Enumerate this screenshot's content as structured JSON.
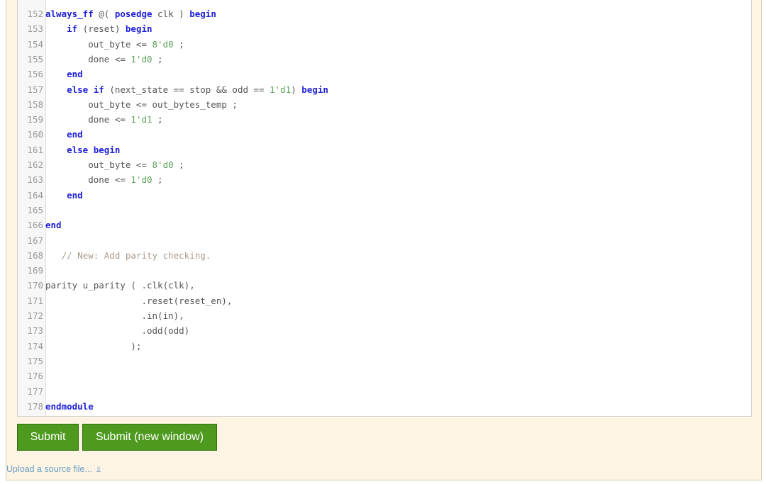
{
  "editor": {
    "lines": [
      {
        "n": "152",
        "segs": [
          {
            "t": "always_ff",
            "c": "kw"
          },
          {
            "t": " @( ",
            "c": "pl"
          },
          {
            "t": "posedge",
            "c": "kw"
          },
          {
            "t": " clk ) ",
            "c": "pl"
          },
          {
            "t": "begin",
            "c": "kw"
          }
        ]
      },
      {
        "n": "153",
        "segs": [
          {
            "t": "    ",
            "c": "pl"
          },
          {
            "t": "if",
            "c": "kw"
          },
          {
            "t": " (reset) ",
            "c": "pl"
          },
          {
            "t": "begin",
            "c": "kw"
          }
        ]
      },
      {
        "n": "154",
        "segs": [
          {
            "t": "        out_byte <= ",
            "c": "pl"
          },
          {
            "t": "8'd0",
            "c": "num"
          },
          {
            "t": " ;",
            "c": "pl"
          }
        ]
      },
      {
        "n": "155",
        "segs": [
          {
            "t": "        done <= ",
            "c": "pl"
          },
          {
            "t": "1'd0",
            "c": "num"
          },
          {
            "t": " ;",
            "c": "pl"
          }
        ]
      },
      {
        "n": "156",
        "segs": [
          {
            "t": "    ",
            "c": "pl"
          },
          {
            "t": "end",
            "c": "kw"
          }
        ]
      },
      {
        "n": "157",
        "segs": [
          {
            "t": "    ",
            "c": "pl"
          },
          {
            "t": "else if",
            "c": "kw"
          },
          {
            "t": " (next_state == stop && odd == ",
            "c": "pl"
          },
          {
            "t": "1'd1",
            "c": "num"
          },
          {
            "t": ") ",
            "c": "pl"
          },
          {
            "t": "begin",
            "c": "kw"
          }
        ]
      },
      {
        "n": "158",
        "segs": [
          {
            "t": "        out_byte <= out_bytes_temp ;",
            "c": "pl"
          }
        ]
      },
      {
        "n": "159",
        "segs": [
          {
            "t": "        done <= ",
            "c": "pl"
          },
          {
            "t": "1'd1",
            "c": "num"
          },
          {
            "t": " ;",
            "c": "pl"
          }
        ]
      },
      {
        "n": "160",
        "segs": [
          {
            "t": "    ",
            "c": "pl"
          },
          {
            "t": "end",
            "c": "kw"
          }
        ]
      },
      {
        "n": "161",
        "segs": [
          {
            "t": "    ",
            "c": "pl"
          },
          {
            "t": "else begin",
            "c": "kw"
          }
        ]
      },
      {
        "n": "162",
        "segs": [
          {
            "t": "        out_byte <= ",
            "c": "pl"
          },
          {
            "t": "8'd0",
            "c": "num"
          },
          {
            "t": " ;",
            "c": "pl"
          }
        ]
      },
      {
        "n": "163",
        "segs": [
          {
            "t": "        done <= ",
            "c": "pl"
          },
          {
            "t": "1'd0",
            "c": "num"
          },
          {
            "t": " ;",
            "c": "pl"
          }
        ]
      },
      {
        "n": "164",
        "segs": [
          {
            "t": "    ",
            "c": "pl"
          },
          {
            "t": "end",
            "c": "kw"
          }
        ]
      },
      {
        "n": "165",
        "segs": []
      },
      {
        "n": "166",
        "segs": [
          {
            "t": "end",
            "c": "kw"
          }
        ]
      },
      {
        "n": "167",
        "segs": []
      },
      {
        "n": "168",
        "segs": [
          {
            "t": "   // New: Add parity checking.",
            "c": "cm"
          }
        ]
      },
      {
        "n": "169",
        "segs": []
      },
      {
        "n": "170",
        "segs": [
          {
            "t": "parity u_parity ( .clk(clk),",
            "c": "pl"
          }
        ]
      },
      {
        "n": "171",
        "segs": [
          {
            "t": "                  .reset(reset_en),",
            "c": "pl"
          }
        ]
      },
      {
        "n": "172",
        "segs": [
          {
            "t": "                  .in(in),",
            "c": "pl"
          }
        ]
      },
      {
        "n": "173",
        "segs": [
          {
            "t": "                  .odd(odd)",
            "c": "pl"
          }
        ]
      },
      {
        "n": "174",
        "segs": [
          {
            "t": "                );",
            "c": "pl"
          }
        ]
      },
      {
        "n": "175",
        "segs": []
      },
      {
        "n": "176",
        "segs": []
      },
      {
        "n": "177",
        "segs": []
      },
      {
        "n": "178",
        "segs": [
          {
            "t": "endmodule",
            "c": "kw"
          }
        ]
      }
    ]
  },
  "actions": {
    "submit_label": "Submit",
    "submit_new_window_label": "Submit (new window)",
    "upload_label": "Upload a source file...",
    "upload_icon": "double-chevron-down-icon"
  }
}
